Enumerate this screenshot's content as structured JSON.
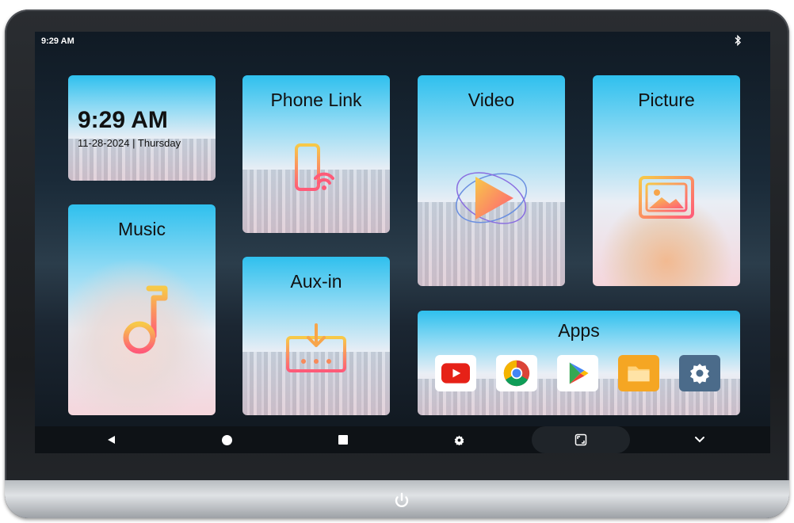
{
  "status_bar": {
    "time": "9:29 AM",
    "bluetooth_icon": "bluetooth-icon"
  },
  "clock_tile": {
    "time": "9:29 AM",
    "date": "11-28-2024 | Thursday"
  },
  "tiles": {
    "phone_link": "Phone Link",
    "video": "Video",
    "picture": "Picture",
    "music": "Music",
    "aux_in": "Aux-in",
    "apps": "Apps"
  },
  "apps": [
    {
      "icon": "youtube-icon",
      "color": "#e62117"
    },
    {
      "icon": "chrome-icon",
      "color": "#4285f4"
    },
    {
      "icon": "play-store-icon",
      "color": "#34a853"
    },
    {
      "icon": "files-icon",
      "color": "#f5a623"
    },
    {
      "icon": "settings-icon",
      "color": "#4b6b8a"
    }
  ],
  "nav_bar": {
    "back": "back-icon",
    "home": "home-icon",
    "recents": "recents-icon",
    "settings": "gear-icon",
    "screen": "screenshot-icon",
    "collapse": "chevron-down-icon"
  },
  "colors": {
    "tile_accent": "#2fc0ee",
    "icon_gradient_start": "#f7c948",
    "icon_gradient_end": "#ff5a78"
  }
}
